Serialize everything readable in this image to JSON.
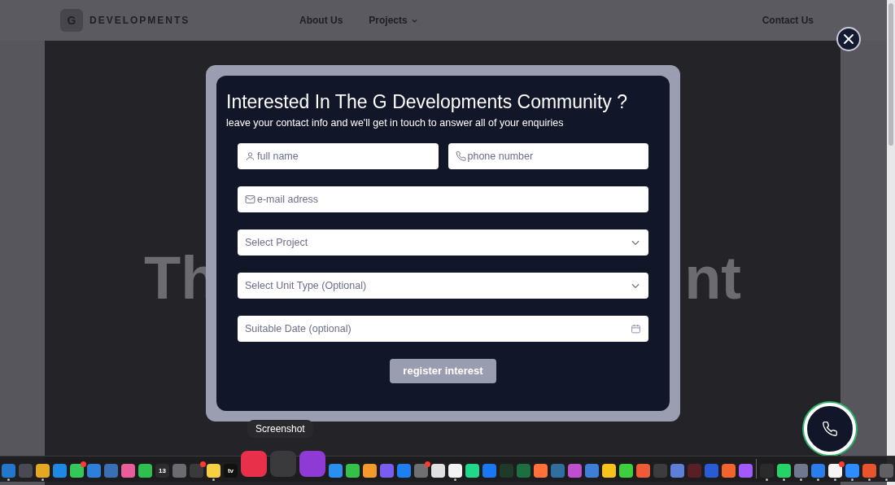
{
  "header": {
    "logo_letter": "G",
    "brand": "DEVELOPMENTS",
    "nav": [
      {
        "label": "About Us",
        "dropdown": false
      },
      {
        "label": "Projects",
        "dropdown": true
      }
    ],
    "contact": "Contact Us"
  },
  "hero": {
    "left_fragment": "Th",
    "right_fragment": "nt"
  },
  "modal": {
    "title": "Interested In The G Developments Community ?",
    "subtitle": "leave your contact info and we'll get in touch to answer all of your enquiries",
    "fields": [
      {
        "kind": "text",
        "placeholder": "full name",
        "half": true
      },
      {
        "kind": "text",
        "placeholder": "phone number",
        "half": true
      },
      {
        "kind": "text",
        "placeholder": "e-mail adress",
        "half": false
      },
      {
        "kind": "select",
        "placeholder": "Select Project",
        "half": false
      },
      {
        "kind": "select",
        "placeholder": "Select Unit Type (Optional)",
        "half": false
      },
      {
        "kind": "date",
        "placeholder": "Suitable Date (optional)",
        "half": false
      }
    ],
    "submit": "register interest"
  },
  "tooltip": "Screenshot",
  "dock": [
    {
      "kind": "app",
      "color": "#2478cc",
      "running": true,
      "badge": false,
      "magnified": false
    },
    {
      "kind": "app",
      "color": "#4a4a55",
      "running": false,
      "badge": false,
      "magnified": false
    },
    {
      "kind": "app",
      "color": "#e5a823",
      "running": true,
      "badge": false,
      "magnified": false
    },
    {
      "kind": "app",
      "color": "#1e88e5",
      "running": false,
      "badge": false,
      "magnified": false
    },
    {
      "kind": "app",
      "color": "#34c759",
      "running": false,
      "badge": true,
      "magnified": false
    },
    {
      "kind": "app",
      "color": "#2f7fd8",
      "running": false,
      "badge": false,
      "magnified": false
    },
    {
      "kind": "app",
      "color": "#3a6fb5",
      "running": false,
      "badge": false,
      "magnified": false
    },
    {
      "kind": "app",
      "color": "#e85d9a",
      "running": false,
      "badge": false,
      "magnified": false
    },
    {
      "kind": "app",
      "color": "#2fbf4f",
      "running": false,
      "badge": false,
      "magnified": false
    },
    {
      "kind": "app",
      "color": "#2c2c2e",
      "running": false,
      "badge": false,
      "magnified": false,
      "label": "13"
    },
    {
      "kind": "app",
      "color": "#6b6b70",
      "running": false,
      "badge": false,
      "magnified": false
    },
    {
      "kind": "app",
      "color": "#3a3a3c",
      "running": false,
      "badge": true,
      "magnified": false
    },
    {
      "kind": "app",
      "color": "#f5d142",
      "running": true,
      "badge": false,
      "magnified": false
    },
    {
      "kind": "app",
      "color": "#111111",
      "running": false,
      "badge": false,
      "magnified": false,
      "label": "tv"
    },
    {
      "kind": "app",
      "color": "#e8304a",
      "running": false,
      "badge": false,
      "magnified": true
    },
    {
      "kind": "app",
      "color": "#3a3a3c",
      "running": false,
      "badge": false,
      "magnified": true
    },
    {
      "kind": "app",
      "color": "#8e3bd6",
      "running": false,
      "badge": false,
      "magnified": true
    },
    {
      "kind": "app",
      "color": "#2b8ff0",
      "running": false,
      "badge": false,
      "magnified": false
    },
    {
      "kind": "app",
      "color": "#35c04a",
      "running": false,
      "badge": false,
      "magnified": false
    },
    {
      "kind": "app",
      "color": "#f39a2b",
      "running": false,
      "badge": false,
      "magnified": false
    },
    {
      "kind": "app",
      "color": "#7b5cf0",
      "running": false,
      "badge": false,
      "magnified": false
    },
    {
      "kind": "app",
      "color": "#1d7ff2",
      "running": false,
      "badge": false,
      "magnified": false
    },
    {
      "kind": "app",
      "color": "#6e6e73",
      "running": false,
      "badge": true,
      "magnified": false
    },
    {
      "kind": "app",
      "color": "#e0e0e0",
      "running": false,
      "badge": false,
      "magnified": false
    },
    {
      "kind": "app",
      "color": "#f2f2f2",
      "running": true,
      "badge": false,
      "magnified": false
    },
    {
      "kind": "app",
      "color": "#21d789",
      "running": false,
      "badge": false,
      "magnified": false
    },
    {
      "kind": "app",
      "color": "#1877f2",
      "running": false,
      "badge": false,
      "magnified": false
    },
    {
      "kind": "app",
      "color": "#1f3a28",
      "running": false,
      "badge": false,
      "magnified": false
    },
    {
      "kind": "app",
      "color": "#1d6f42",
      "running": false,
      "badge": false,
      "magnified": false
    },
    {
      "kind": "app",
      "color": "#ff7139",
      "running": false,
      "badge": false,
      "magnified": false
    },
    {
      "kind": "app",
      "color": "#2f6f9f",
      "running": false,
      "badge": false,
      "magnified": false
    },
    {
      "kind": "app",
      "color": "#c04fd0",
      "running": false,
      "badge": false,
      "magnified": false
    },
    {
      "kind": "app",
      "color": "#3d7fd6",
      "running": false,
      "badge": false,
      "magnified": false
    },
    {
      "kind": "app",
      "color": "#f7c21e",
      "running": false,
      "badge": false,
      "magnified": false
    },
    {
      "kind": "app",
      "color": "#3ecf3e",
      "running": false,
      "badge": false,
      "magnified": false
    },
    {
      "kind": "app",
      "color": "#f05a36",
      "running": false,
      "badge": false,
      "magnified": false
    },
    {
      "kind": "app",
      "color": "#3c3c3e",
      "running": false,
      "badge": false,
      "magnified": false
    },
    {
      "kind": "app",
      "color": "#5e7fd8",
      "running": false,
      "badge": false,
      "magnified": false
    },
    {
      "kind": "app",
      "color": "#5a1f24",
      "running": false,
      "badge": false,
      "magnified": false
    },
    {
      "kind": "app",
      "color": "#2a5bd7",
      "running": false,
      "badge": false,
      "magnified": false
    },
    {
      "kind": "app",
      "color": "#f0652b",
      "running": false,
      "badge": false,
      "magnified": false
    },
    {
      "kind": "app",
      "color": "#a259ff",
      "running": false,
      "badge": false,
      "magnified": false
    },
    {
      "kind": "separator"
    },
    {
      "kind": "app",
      "color": "#2a2a2a",
      "running": true,
      "badge": false,
      "magnified": false
    },
    {
      "kind": "app",
      "color": "#25d366",
      "running": true,
      "badge": false,
      "magnified": false
    },
    {
      "kind": "app",
      "color": "#707890",
      "running": true,
      "badge": false,
      "magnified": false
    },
    {
      "kind": "app",
      "color": "#2b7de9",
      "running": true,
      "badge": false,
      "magnified": false
    },
    {
      "kind": "app",
      "color": "#f4f4f4",
      "running": true,
      "badge": true,
      "magnified": false
    },
    {
      "kind": "app",
      "color": "#2d8cff",
      "running": true,
      "badge": false,
      "magnified": false
    },
    {
      "kind": "app",
      "color": "#e8552c",
      "running": true,
      "badge": false,
      "magnified": false
    },
    {
      "kind": "app",
      "color": "#5f5f64",
      "running": true,
      "badge": false,
      "magnified": false
    }
  ]
}
